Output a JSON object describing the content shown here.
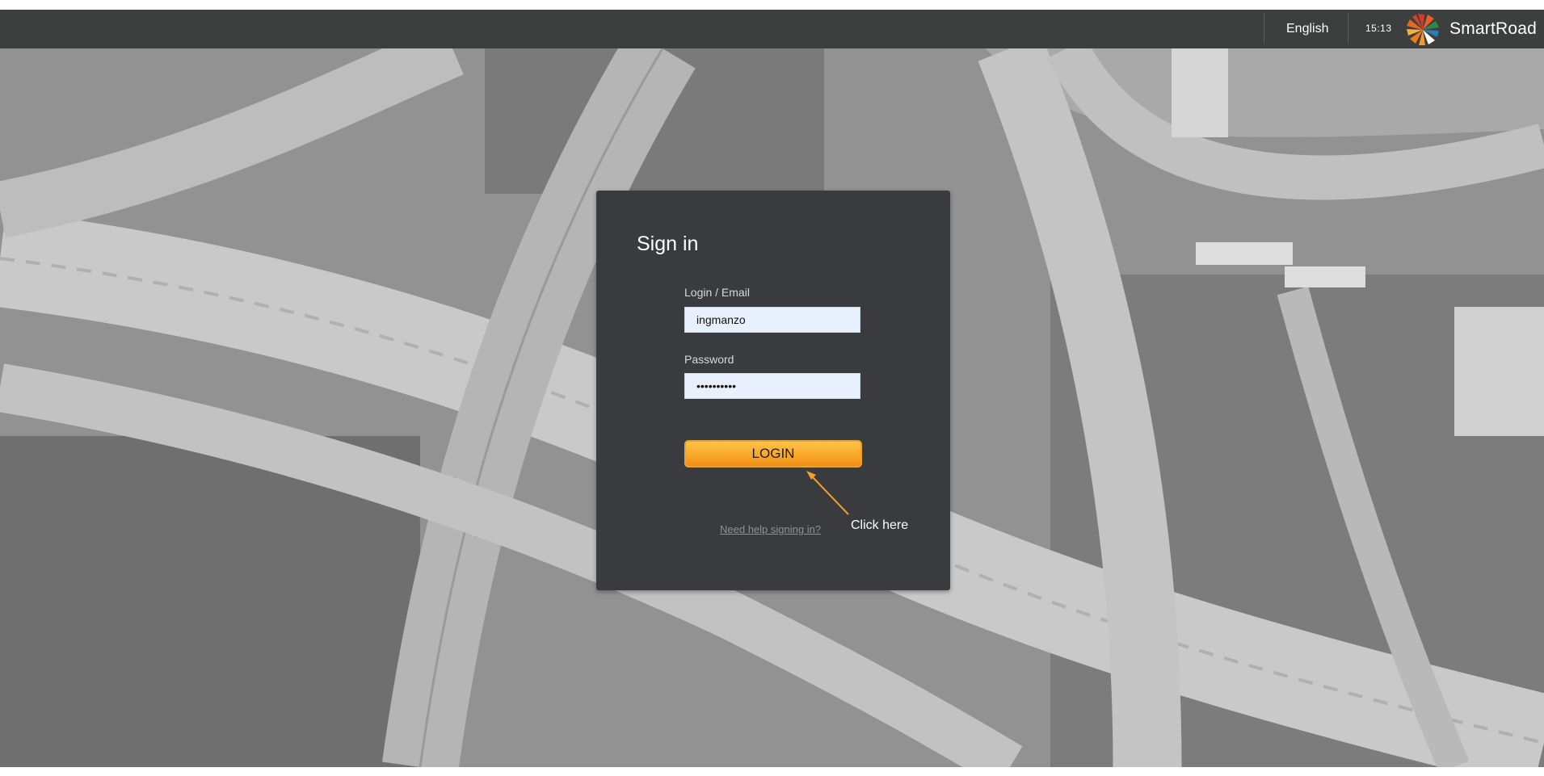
{
  "header": {
    "language": "English",
    "time": "15:13",
    "brand": "SmartRoad"
  },
  "login_form": {
    "title": "Sign in",
    "login_label": "Login / Email",
    "login_value": "ingmanzo",
    "password_label": "Password",
    "password_value": "••••••••••",
    "login_button": "LOGIN",
    "help_link": "Need help signing in?"
  },
  "annotation": {
    "text": "Click here",
    "color": "#f0a22a"
  },
  "colors": {
    "topbar": "#3d3e3e",
    "card": "#3a3b3e",
    "button_accent": "#f7a82a",
    "input_bg": "#e8f0fe"
  },
  "icons": {
    "logo": "smartroad-logo-icon"
  }
}
